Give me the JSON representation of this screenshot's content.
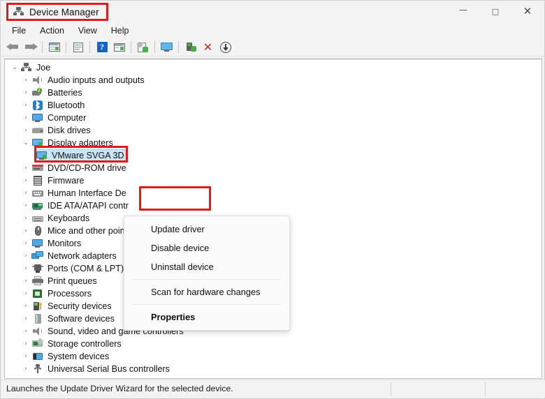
{
  "window": {
    "title": "Device Manager",
    "title_icon": "device-manager-icon",
    "minimize": "—",
    "maximize": "□",
    "close": "✕"
  },
  "menubar": {
    "items": [
      {
        "label": "File"
      },
      {
        "label": "Action"
      },
      {
        "label": "View"
      },
      {
        "label": "Help"
      }
    ]
  },
  "toolbar": {
    "buttons": [
      {
        "name": "back-icon",
        "tip": "Back"
      },
      {
        "name": "forward-icon",
        "tip": "Forward"
      },
      {
        "name": "show-hide-console-tree-icon",
        "tip": "Show/Hide Console Tree"
      },
      {
        "name": "properties-icon",
        "tip": "Properties"
      },
      {
        "name": "help-icon",
        "tip": "Help"
      },
      {
        "name": "show-hide-action-pane-icon",
        "tip": "Show/Hide Action Pane"
      },
      {
        "name": "update-driver-icon",
        "tip": "Update driver"
      },
      {
        "name": "scan-for-hardware-changes-icon",
        "tip": "Scan for hardware changes"
      },
      {
        "name": "enable-device-icon",
        "tip": "Enable device"
      },
      {
        "name": "uninstall-device-icon",
        "tip": "Uninstall device"
      },
      {
        "name": "download-icon",
        "tip": "Download"
      }
    ]
  },
  "tree": {
    "root": {
      "label": "Joe",
      "icon": "device-manager-icon",
      "expanded": true
    },
    "items": [
      {
        "label": "Audio inputs and outputs",
        "icon": "speaker-icon",
        "expanded": false,
        "level": 1
      },
      {
        "label": "Batteries",
        "icon": "battery-icon",
        "expanded": false,
        "level": 1
      },
      {
        "label": "Bluetooth",
        "icon": "bluetooth-icon",
        "expanded": false,
        "level": 1
      },
      {
        "label": "Computer",
        "icon": "monitor-icon",
        "expanded": false,
        "level": 1
      },
      {
        "label": "Disk drives",
        "icon": "disk-drive-icon",
        "expanded": false,
        "level": 1
      },
      {
        "label": "Display adapters",
        "icon": "display-adapter-icon",
        "expanded": true,
        "level": 1
      },
      {
        "label": "VMware SVGA 3D",
        "icon": "display-adapter-icon",
        "selected": true,
        "level": 2
      },
      {
        "label": "DVD/CD-ROM drive",
        "icon": "dvd-drive-icon",
        "expanded": false,
        "level": 1
      },
      {
        "label": "Firmware",
        "icon": "firmware-icon",
        "expanded": false,
        "level": 1
      },
      {
        "label": "Human Interface De",
        "icon": "hid-icon",
        "expanded": false,
        "level": 1
      },
      {
        "label": "IDE ATA/ATAPI contr",
        "icon": "ide-controller-icon",
        "expanded": false,
        "level": 1
      },
      {
        "label": "Keyboards",
        "icon": "keyboard-icon",
        "expanded": false,
        "level": 1
      },
      {
        "label": "Mice and other poin",
        "icon": "mouse-icon",
        "expanded": false,
        "level": 1
      },
      {
        "label": "Monitors",
        "icon": "monitor-icon",
        "expanded": false,
        "level": 1
      },
      {
        "label": "Network adapters",
        "icon": "network-adapter-icon",
        "expanded": false,
        "level": 1
      },
      {
        "label": "Ports (COM & LPT)",
        "icon": "port-icon",
        "expanded": false,
        "level": 1
      },
      {
        "label": "Print queues",
        "icon": "printer-icon",
        "expanded": false,
        "level": 1
      },
      {
        "label": "Processors",
        "icon": "processor-icon",
        "expanded": false,
        "level": 1
      },
      {
        "label": "Security devices",
        "icon": "security-device-icon",
        "expanded": false,
        "level": 1
      },
      {
        "label": "Software devices",
        "icon": "software-device-icon",
        "expanded": false,
        "level": 1
      },
      {
        "label": "Sound, video and game controllers",
        "icon": "speaker-icon",
        "expanded": false,
        "level": 1
      },
      {
        "label": "Storage controllers",
        "icon": "storage-controller-icon",
        "expanded": false,
        "level": 1
      },
      {
        "label": "System devices",
        "icon": "system-device-icon",
        "expanded": false,
        "level": 1
      },
      {
        "label": "Universal Serial Bus controllers",
        "icon": "usb-icon",
        "expanded": false,
        "level": 1
      }
    ],
    "chevron_collapsed": "›",
    "chevron_expanded": "⌄"
  },
  "context_menu": {
    "items": [
      {
        "label": "Update driver",
        "type": "item"
      },
      {
        "label": "Disable device",
        "type": "item"
      },
      {
        "label": "Uninstall device",
        "type": "item",
        "highlighted": true
      },
      {
        "type": "separator"
      },
      {
        "label": "Scan for hardware changes",
        "type": "item"
      },
      {
        "type": "separator"
      },
      {
        "label": "Properties",
        "type": "item",
        "bold": true
      }
    ]
  },
  "status_bar": {
    "text": "Launches the Update Driver Wizard for the selected device."
  },
  "annotations": {
    "color": "#e01b1b",
    "boxes": [
      {
        "name": "title-highlight",
        "target": "Device Manager"
      },
      {
        "name": "selected-device-highlight",
        "target": "VMware SVGA 3D"
      },
      {
        "name": "uninstall-device-highlight",
        "target": "Uninstall device"
      }
    ]
  }
}
